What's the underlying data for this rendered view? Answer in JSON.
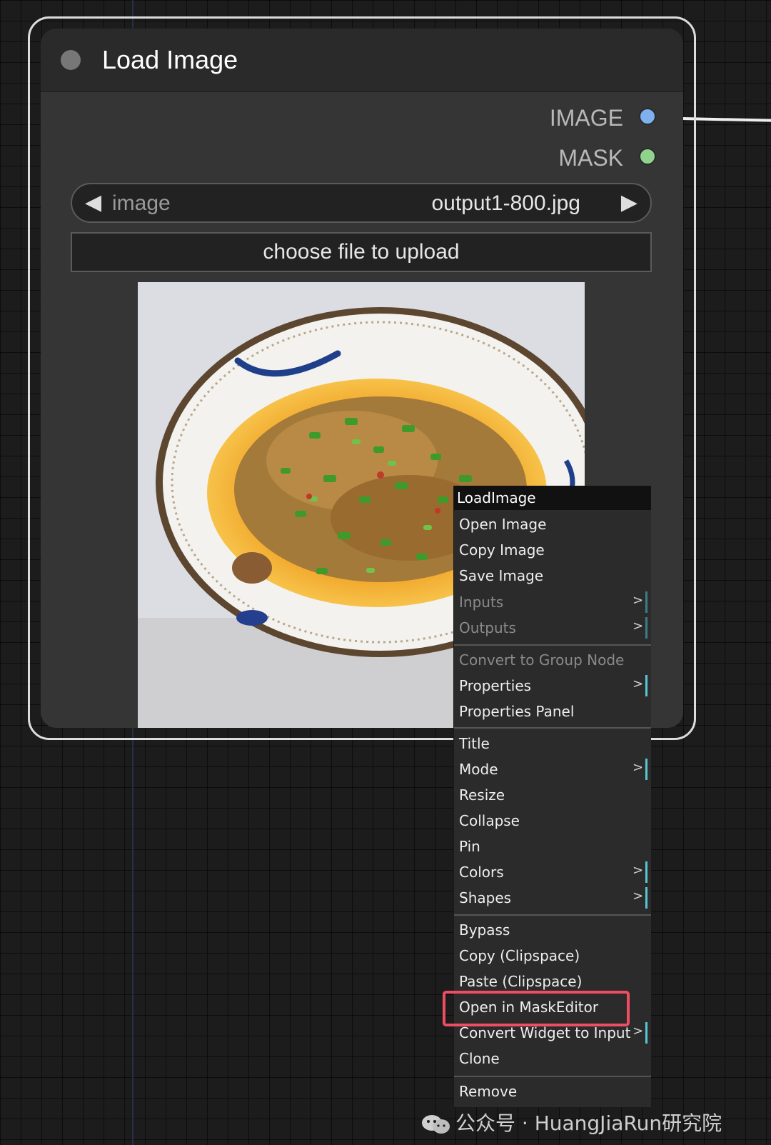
{
  "node": {
    "title": "Load Image",
    "outputs": [
      {
        "label": "IMAGE",
        "color": "#7fb0f0"
      },
      {
        "label": "MASK",
        "color": "#8fd38c"
      }
    ],
    "combo": {
      "name": "image",
      "value": "output1-800.jpg",
      "left_arrow": "◀",
      "right_arrow": "▶"
    },
    "upload_label": "choose file to upload"
  },
  "context_menu": {
    "title": "LoadImage",
    "items": [
      {
        "label": "Open Image"
      },
      {
        "label": "Copy Image"
      },
      {
        "label": "Save Image"
      },
      {
        "label": "Inputs",
        "submenu": ">"
      },
      {
        "label": "Outputs",
        "submenu": ">"
      },
      {
        "label": "Convert to Group Node"
      },
      {
        "label": "Properties",
        "submenu": ">"
      },
      {
        "label": "Properties Panel"
      },
      {
        "label": "Title"
      },
      {
        "label": "Mode",
        "submenu": ">"
      },
      {
        "label": "Resize"
      },
      {
        "label": "Collapse"
      },
      {
        "label": "Pin"
      },
      {
        "label": "Colors",
        "submenu": ">"
      },
      {
        "label": "Shapes",
        "submenu": ">"
      },
      {
        "label": "Bypass"
      },
      {
        "label": "Copy (Clipspace)"
      },
      {
        "label": "Paste (Clipspace)"
      },
      {
        "label": "Open in MaskEditor"
      },
      {
        "label": "Convert Widget to Input",
        "submenu": ">"
      },
      {
        "label": "Clone"
      },
      {
        "label": "Remove"
      }
    ],
    "highlight_color": "#ef4d63"
  },
  "watermark": {
    "text": "公众号 · HuangJiaRun研究院",
    "icon": "wechat-icon"
  }
}
